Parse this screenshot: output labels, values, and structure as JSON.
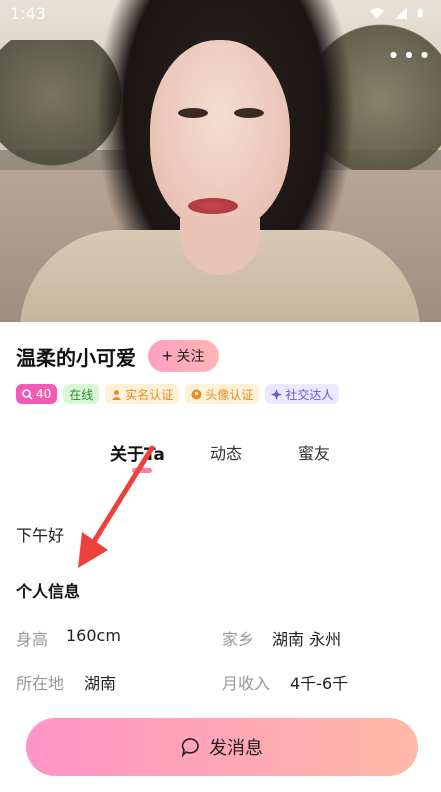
{
  "status_bar": {
    "time": "1:43"
  },
  "profile": {
    "name": "温柔的小可爱",
    "follow_label": "关注",
    "badges": {
      "search_count": "40",
      "online": "在线",
      "real_name": "实名认证",
      "avatar": "头像认证",
      "social": "社交达人"
    }
  },
  "tabs": [
    "关于Ta",
    "动态",
    "蜜友"
  ],
  "greeting": "下午好",
  "personal_info": {
    "title": "个人信息",
    "height_label": "身高",
    "height_value": "160cm",
    "hometown_label": "家乡",
    "hometown_value": "湖南 永州",
    "location_label": "所在地",
    "location_value": "湖南",
    "income_label": "月收入",
    "income_value": "4千-6千"
  },
  "actions": {
    "send_message": "发消息"
  },
  "colors": {
    "accent_pink": "#f77fb0",
    "button_gradient_start": "#ff94c7",
    "button_gradient_end": "#ffb8a6",
    "arrow_red": "#f0403c"
  }
}
